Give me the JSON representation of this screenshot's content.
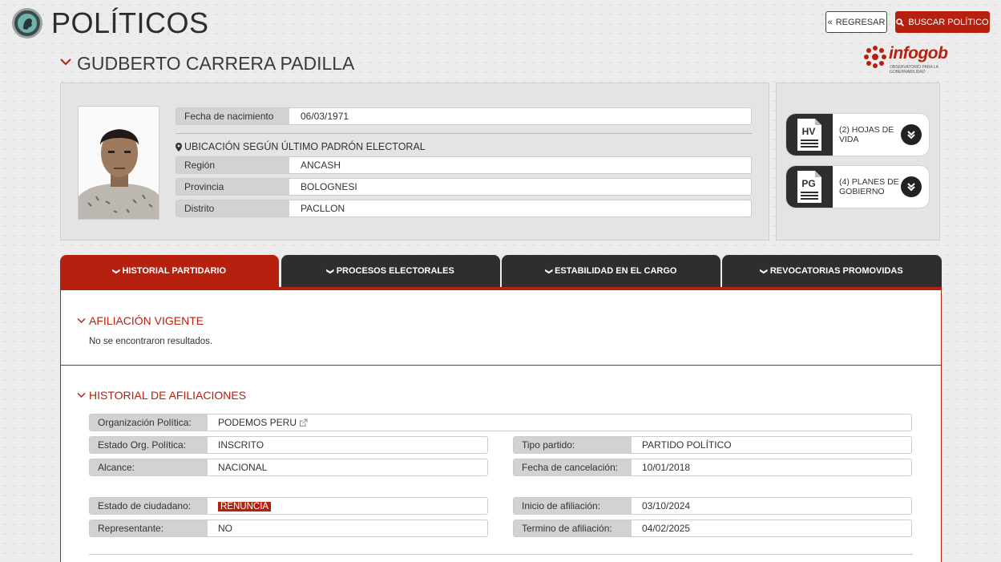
{
  "header": {
    "title": "POLÍTICOS",
    "back_label": "REGRESAR",
    "search_label": "BUSCAR POLÍTICO",
    "person_name": "GUDBERTO CARRERA PADILLA",
    "brand": "infogob",
    "brand_sub": "OBSERVATORIO PARA LA GOBERNABILIDAD"
  },
  "profile": {
    "birth_label": "Fecha de nacimiento",
    "birth_value": "06/03/1971",
    "location_title": "UBICACIÓN SEGÚN ÚLTIMO PADRÓN ELECTORAL",
    "region_label": "Región",
    "region_value": "ANCASH",
    "provincia_label": "Provincia",
    "provincia_value": "BOLOGNESI",
    "distrito_label": "Distrito",
    "distrito_value": "PACLLON"
  },
  "documents": [
    {
      "icon_text": "HV",
      "label": "(2) HOJAS DE VIDA"
    },
    {
      "icon_text": "PG",
      "label": "(4) PLANES DE GOBIERNO"
    }
  ],
  "tabs": [
    {
      "label": "HISTORIAL PARTIDARIO"
    },
    {
      "label": "PROCESOS ELECTORALES"
    },
    {
      "label": "ESTABILIDAD EN EL CARGO"
    },
    {
      "label": "REVOCATORIAS PROMOVIDAS"
    }
  ],
  "afiliacion_vigente": {
    "title": "AFILIACIÓN VIGENTE",
    "message": "No se encontraron resultados."
  },
  "historial": {
    "title": "HISTORIAL DE AFILIACIONES",
    "org_label": "Organización Política:",
    "org_value": "PODEMOS PERU",
    "estado_org_label": "Estado Org. Política:",
    "estado_org_value": "INSCRITO",
    "tipo_label": "Tipo partido:",
    "tipo_value": "PARTIDO POLÍTICO",
    "alcance_label": "Alcance:",
    "alcance_value": "NACIONAL",
    "cancel_label": "Fecha de cancelación:",
    "cancel_value": "10/01/2018",
    "estado_ciud_label": "Estado de ciudadano:",
    "estado_ciud_value": "RENUNCIA",
    "inicio_label": "Inicio de afiliación:",
    "inicio_value": "03/10/2024",
    "rep_label": "Representante:",
    "rep_value": "NO",
    "termino_label": "Termino de afiliación:",
    "termino_value": "04/02/2025"
  },
  "colors": {
    "accent": "#b5200f",
    "dark": "#2e2e2e"
  }
}
